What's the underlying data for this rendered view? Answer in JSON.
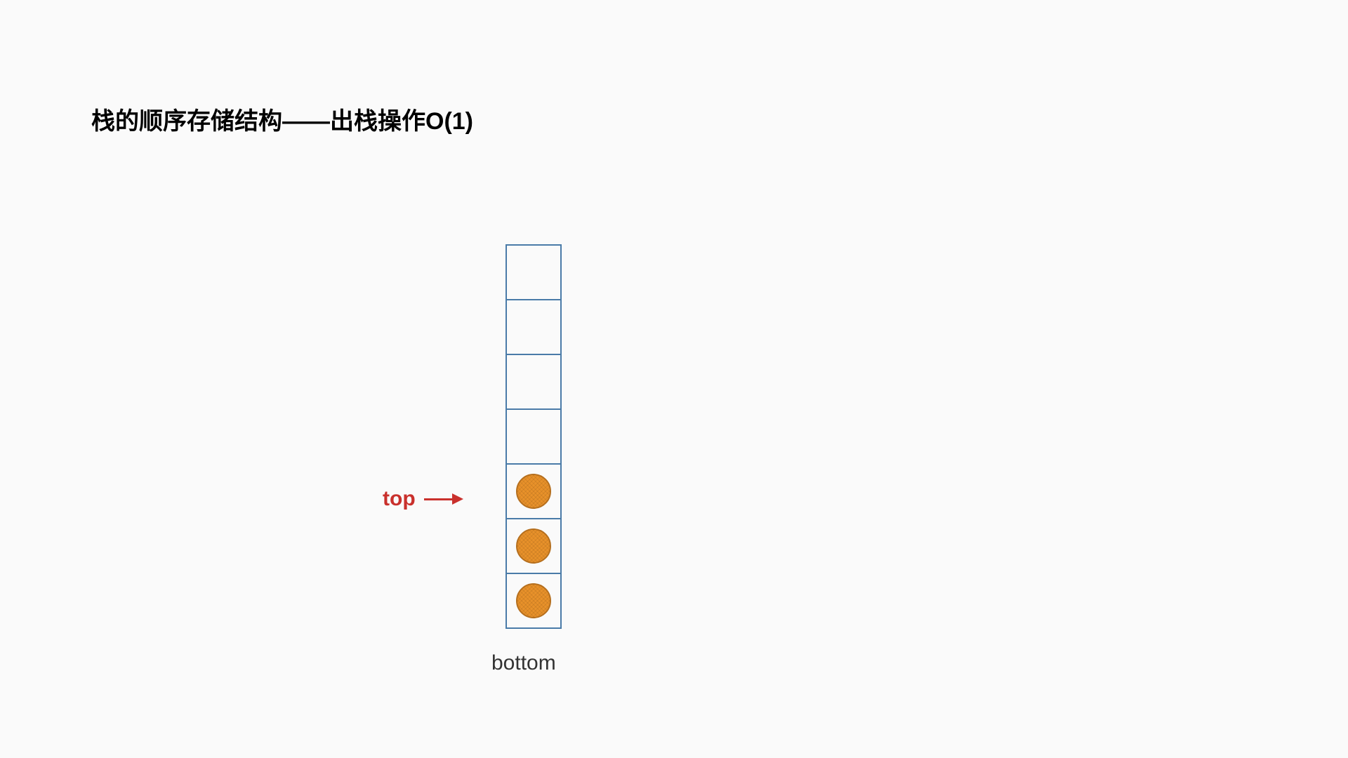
{
  "title": "栈的顺序存储结构——出栈操作O(1)",
  "labels": {
    "top": "top",
    "bottom": "bottom"
  },
  "stack": {
    "total_cells": 7,
    "filled_from_bottom": 3,
    "top_pointer_index_from_top": 4
  },
  "colors": {
    "cell_border": "#4a7ba8",
    "ball_fill": "#e8912a",
    "ball_border": "#b56f1e",
    "pointer": "#c9302c"
  }
}
